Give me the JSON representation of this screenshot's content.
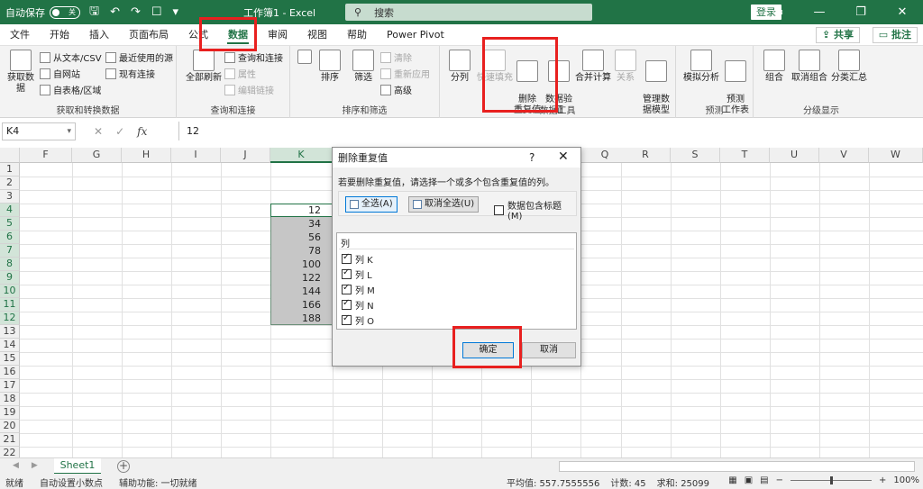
{
  "titlebar": {
    "autosave_label": "自动保存",
    "autosave_state": "关",
    "title": "工作簿1  -  Excel",
    "search_placeholder": "搜索",
    "login_label": "登录"
  },
  "tabs": [
    "文件",
    "开始",
    "插入",
    "页面布局",
    "公式",
    "数据",
    "审阅",
    "视图",
    "帮助",
    "Power Pivot"
  ],
  "active_tab": "数据",
  "share_label": "共享",
  "comment_label": "批注",
  "ribbon": {
    "get_data": {
      "label": "获取和转换数据",
      "big": "获取数据",
      "from_text": "从文本/CSV",
      "from_web": "自网站",
      "from_table": "自表格/区域",
      "recent": "最近使用的源",
      "existing": "现有连接"
    },
    "queries": {
      "label": "查询和连接",
      "refresh": "全部刷新",
      "q_conn": "查询和连接",
      "props": "属性",
      "edit_links": "编辑链接"
    },
    "sort": {
      "label": "排序和筛选",
      "sort": "排序",
      "filter": "筛选",
      "clear": "清除",
      "reapply": "重新应用",
      "advanced": "高级"
    },
    "tools": {
      "label": "数据工具",
      "split": "分列",
      "flash": "快速填充",
      "remove_dup": "删除\n重复值",
      "validation": "数据验\n证",
      "consolidate": "合并计算",
      "relations": "关系",
      "model": "管理数\n据模型"
    },
    "forecast": {
      "label": "预测",
      "whatif": "模拟分析",
      "sheet": "预测\n工作表"
    },
    "outline": {
      "label": "分级显示",
      "group": "组合",
      "ungroup": "取消组合",
      "subtotal": "分类汇总"
    }
  },
  "formula_bar": {
    "name_box": "K4",
    "formula": "12"
  },
  "columns": [
    "F",
    "G",
    "H",
    "I",
    "J",
    "K",
    "L",
    "M",
    "N",
    "O",
    "P",
    "Q",
    "R",
    "S",
    "T",
    "U",
    "V",
    "W"
  ],
  "rows": [
    "1",
    "2",
    "3",
    "4",
    "5",
    "6",
    "7",
    "8",
    "9",
    "10",
    "11",
    "12",
    "13",
    "14",
    "15",
    "16",
    "17",
    "18",
    "19",
    "20",
    "21",
    "22"
  ],
  "cell_values": [
    "12",
    "34",
    "56",
    "78",
    "100",
    "122",
    "144",
    "166",
    "188"
  ],
  "sheet_tab": "Sheet1",
  "status": {
    "ready": "就绪",
    "auto_decimal": "自动设置小数点",
    "accessibility": "辅助功能: 一切就绪",
    "average": "平均值: 557.7555556",
    "count": "计数: 45",
    "sum": "求和: 25099",
    "zoom": "100%"
  },
  "dialog": {
    "title": "删除重复值",
    "help": "?",
    "description": "若要删除重复值，请选择一个或多个包含重复值的列。",
    "select_all": "全选(A)",
    "unselect_all": "取消全选(U)",
    "has_headers": "数据包含标题(M)",
    "list_header": "列",
    "columns": [
      "列 K",
      "列 L",
      "列 M",
      "列 N",
      "列 O"
    ],
    "ok": "确定",
    "cancel": "取消"
  },
  "colors": {
    "excel_green": "#217346",
    "annotation_red": "#e8201f"
  }
}
